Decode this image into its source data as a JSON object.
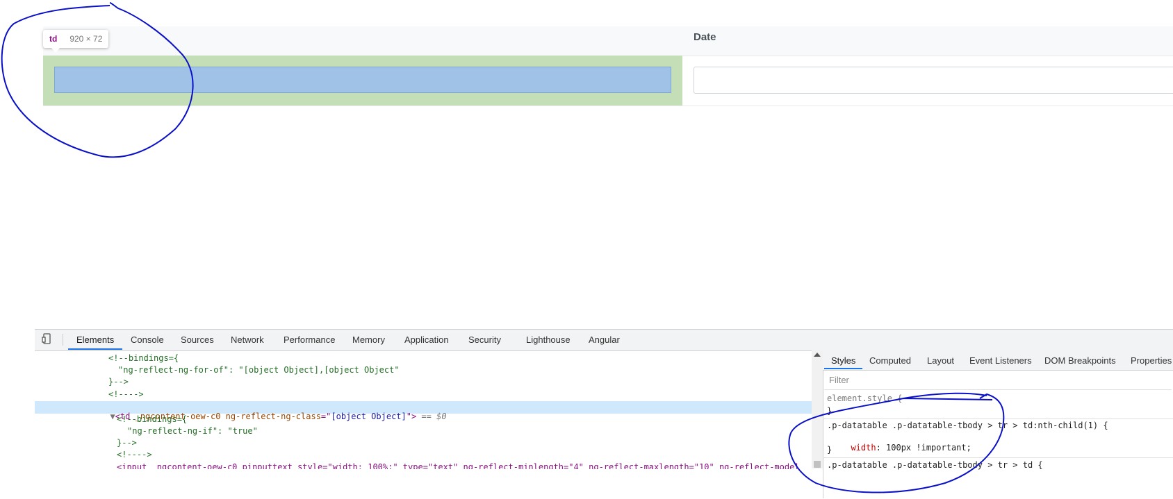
{
  "table": {
    "date_header": "Date",
    "date_input_value": ""
  },
  "tooltip": {
    "tag": "td",
    "dims": "920 × 72"
  },
  "devtools": {
    "tabs": [
      "Elements",
      "Console",
      "Sources",
      "Network",
      "Performance",
      "Memory",
      "Application",
      "Security",
      "Lighthouse",
      "Angular"
    ],
    "active_tab": "Elements",
    "code": {
      "line1": "<!--bindings={",
      "line2": "\"ng-reflect-ng-for-of\": \"[object Object],[object Object\"",
      "line3": "}-->",
      "line4": "<!---->",
      "sel_open": "<td",
      "sel_attr1": " _ngcontent-oew-c0",
      "sel_attr2": " ng-reflect-ng-class",
      "sel_eq": "=\"",
      "sel_val": "[object Object]",
      "sel_close": "\">",
      "sel_marker": " == $0",
      "line6": "<!--bindings={",
      "line7": "\"ng-reflect-ng-if\": \"true\"",
      "line8": "}-->",
      "line9": "<!---->",
      "line10": "<input _ngcontent-oew-c0 pinputtext style=\"width: 100%;\" type=\"text\" ng-reflect-minlength=\"4\" ng-reflect-maxlength=\"10\" ng-reflect-model"
    }
  },
  "styles_pane": {
    "tabs": [
      "Styles",
      "Computed",
      "Layout",
      "Event Listeners",
      "DOM Breakpoints",
      "Properties"
    ],
    "active_tab": "Styles",
    "filter_placeholder": "Filter",
    "element_style_open": "element.style {",
    "element_style_close": "}",
    "rule1_selector": ".p-datatable .p-datatable-tbody > tr > td:nth-child(1) {",
    "rule1_prop": "width",
    "rule1_value": "100px !important;",
    "rule1_close": "}",
    "rule2_selector": ".p-datatable .p-datatable-tbody > tr > td {"
  },
  "colors": {
    "highlight_green": "#c4dfb8",
    "highlight_blue": "#a0c2e6",
    "annotation_ink": "#0a10c8",
    "active_tab_accent": "#1a73e8"
  }
}
